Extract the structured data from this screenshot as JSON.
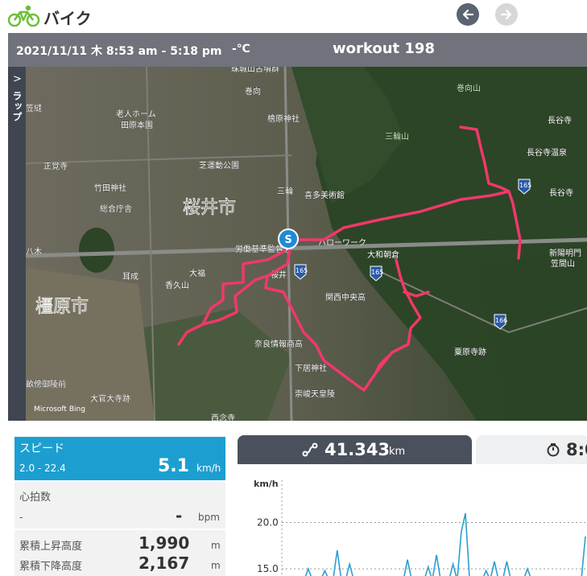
{
  "header": {
    "title": "バイク",
    "icons": {
      "activity": "bike-icon",
      "back": "arrow-left-icon",
      "forward": "arrow-right-icon"
    }
  },
  "workout": {
    "date_time": "2021/11/11 木 8:53 am - 5:18 pm",
    "temperature": "-℃",
    "name": "workout 198"
  },
  "map": {
    "lap_tab_label": "ラップ",
    "start_marker": "S",
    "watermark": "Microsoft Bing",
    "place_labels": [
      "珠城山古墳群",
      "巻向",
      "巻向山",
      "笠縫",
      "老人ホーム",
      "田原本園",
      "檜原神社",
      "三輪山",
      "長谷寺",
      "正覚寺",
      "芝運動公園",
      "竹田神社",
      "総合庁舎",
      "三輪",
      "喜多美術館",
      "長谷寺温泉",
      "長谷寺",
      "桜井市",
      "八木",
      "労働基準監督署",
      "ハローワーク",
      "大和朝倉",
      "新陽明門",
      "笠間山",
      "耳成",
      "大福",
      "香久山",
      "桜井",
      "関西中央高",
      "橿原市",
      "奈良情報商高",
      "下居神社",
      "粟原寺跡",
      "崇峻天皇陵",
      "西念寺",
      "大官大寺跡",
      "畝傍御陵前"
    ],
    "road_shields": [
      "165",
      "165",
      "165",
      "166"
    ],
    "route_color": "#f0386b"
  },
  "stats": {
    "speed": {
      "label": "スピード",
      "range": "2.0 - 22.4",
      "value": "5.1",
      "unit": "km/h"
    },
    "heart_rate": {
      "label": "心拍数",
      "range": "-",
      "value": "-",
      "unit": "bpm"
    },
    "ascent": {
      "label": "累積上昇高度",
      "value": "1,990",
      "unit": "m"
    },
    "descent": {
      "label": "累積下降高度",
      "value": "2,167",
      "unit": "m"
    }
  },
  "tabs": {
    "distance": {
      "value": "41.343",
      "unit": "km",
      "icon": "route-icon"
    },
    "time": {
      "value": "8:0",
      "icon": "stopwatch-icon"
    }
  },
  "chart_data": {
    "type": "line",
    "ylabel": "km/h",
    "yticks": [
      "20.0",
      "15.0"
    ],
    "ylim": [
      14.4,
      25.6
    ],
    "series": [
      {
        "values": [
          0,
          14,
          0,
          0,
          0,
          0,
          15,
          0,
          0,
          0,
          14.8,
          0,
          0,
          17,
          0,
          0,
          15.5,
          0,
          0,
          0,
          0,
          0,
          0,
          0,
          0,
          0,
          0,
          0,
          0,
          0,
          16,
          0,
          0,
          0,
          0,
          15.2,
          0,
          16.5,
          0,
          0,
          0,
          15.5,
          0,
          19,
          21,
          0,
          0,
          0,
          0,
          14.8,
          0,
          15.8,
          0,
          0,
          15.8,
          0,
          0,
          0,
          0,
          15,
          0,
          0,
          0,
          0,
          0,
          0,
          0,
          0,
          0,
          0,
          0,
          0,
          0,
          18.5
        ]
      }
    ]
  }
}
